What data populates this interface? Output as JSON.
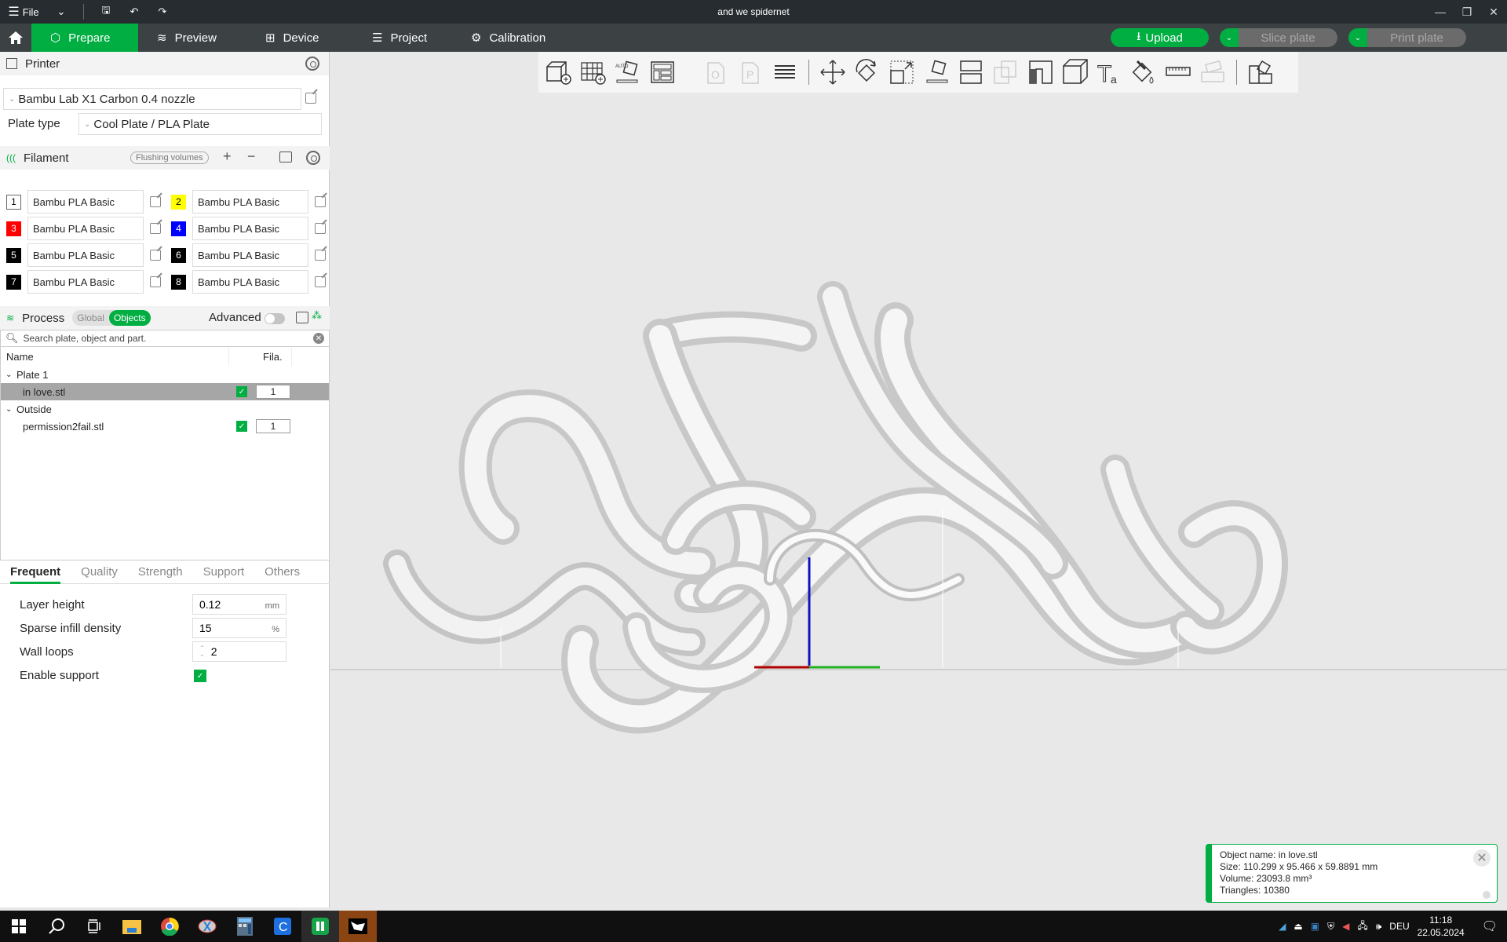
{
  "window": {
    "title": "and we spidernet",
    "file_label": "File"
  },
  "nav": {
    "tabs": [
      {
        "label": "Prepare",
        "icon": "cube-icon",
        "active": true
      },
      {
        "label": "Preview",
        "icon": "layers-icon"
      },
      {
        "label": "Device",
        "icon": "device-icon"
      },
      {
        "label": "Project",
        "icon": "project-icon"
      },
      {
        "label": "Calibration",
        "icon": "calibration-icon"
      }
    ],
    "upload_label": "Upload",
    "slice_label": "Slice plate",
    "print_label": "Print plate",
    "accent": "#00ae42"
  },
  "printer": {
    "section_label": "Printer",
    "printer_name": "Bambu Lab X1 Carbon 0.4 nozzle",
    "plate_type_label": "Plate type",
    "plate_type": "Cool Plate / PLA Plate"
  },
  "filament": {
    "section_label": "Filament",
    "flushing_label": "Flushing volumes",
    "items": [
      {
        "num": "1",
        "name": "Bambu PLA Basic",
        "color": "#ffffff",
        "text": "#262626"
      },
      {
        "num": "2",
        "name": "Bambu PLA Basic",
        "color": "#ffff00",
        "text": "#262626"
      },
      {
        "num": "3",
        "name": "Bambu PLA Basic",
        "color": "#ff0000",
        "text": "#ffffff"
      },
      {
        "num": "4",
        "name": "Bambu PLA Basic",
        "color": "#0000ff",
        "text": "#ffffff"
      },
      {
        "num": "5",
        "name": "Bambu PLA Basic",
        "color": "#000000",
        "text": "#ffffff"
      },
      {
        "num": "6",
        "name": "Bambu PLA Basic",
        "color": "#000000",
        "text": "#ffffff"
      },
      {
        "num": "7",
        "name": "Bambu PLA Basic",
        "color": "#000000",
        "text": "#ffffff"
      },
      {
        "num": "8",
        "name": "Bambu PLA Basic",
        "color": "#000000",
        "text": "#ffffff"
      }
    ]
  },
  "process": {
    "section_label": "Process",
    "global_label": "Global",
    "objects_label": "Objects",
    "advanced_label": "Advanced",
    "advanced_on": false,
    "search_placeholder": "Search plate, object and part."
  },
  "tree": {
    "col_name": "Name",
    "col_fila": "Fila.",
    "groups": [
      {
        "label": "Plate 1",
        "items": [
          {
            "name": "in love.stl",
            "checked": true,
            "fila": "1",
            "selected": true
          }
        ]
      },
      {
        "label": "Outside",
        "items": [
          {
            "name": "permission2fail.stl",
            "checked": true,
            "fila": "1",
            "selected": false
          }
        ]
      }
    ]
  },
  "settings": {
    "tabs": [
      "Frequent",
      "Quality",
      "Strength",
      "Support",
      "Others"
    ],
    "active_tab": "Frequent",
    "layer_height_label": "Layer height",
    "layer_height": "0.12",
    "layer_height_unit": "mm",
    "infill_label": "Sparse infill density",
    "infill": "15",
    "infill_unit": "%",
    "wall_loops_label": "Wall loops",
    "wall_loops": "2",
    "support_label": "Enable support",
    "support_enabled": true
  },
  "toolbar": {
    "tools": [
      "add-object-icon",
      "add-plate-icon",
      "auto-orient-icon",
      "arrange-icon",
      "copy-object-icon",
      "paste-object-icon",
      "layers-list-icon",
      "move-icon",
      "rotate-icon",
      "scale-icon",
      "lay-on-face-icon",
      "cut-icon",
      "boolean-icon",
      "support-paint-icon",
      "seam-paint-icon",
      "text-icon",
      "color-paint-icon",
      "measure-icon",
      "assembly-icon",
      "split-icon"
    ]
  },
  "object_info": {
    "name_line": "Object name: in love.stl",
    "size_line": "Size: 110.299 x 95.466 x 59.8891 mm",
    "volume_line": "Volume: 23093.8 mm³",
    "triangles_line": "Triangles: 10380"
  },
  "taskbar": {
    "apps": [
      "windows-start-icon",
      "search-icon",
      "task-view-icon",
      "file-explorer-icon",
      "chrome-icon",
      "snipping-tool-icon",
      "calculator-icon",
      "app-c-icon",
      "sheets-app-icon",
      "rhino-icon"
    ],
    "lang": "DEU",
    "time": "11:18",
    "date": "22.05.2024"
  }
}
